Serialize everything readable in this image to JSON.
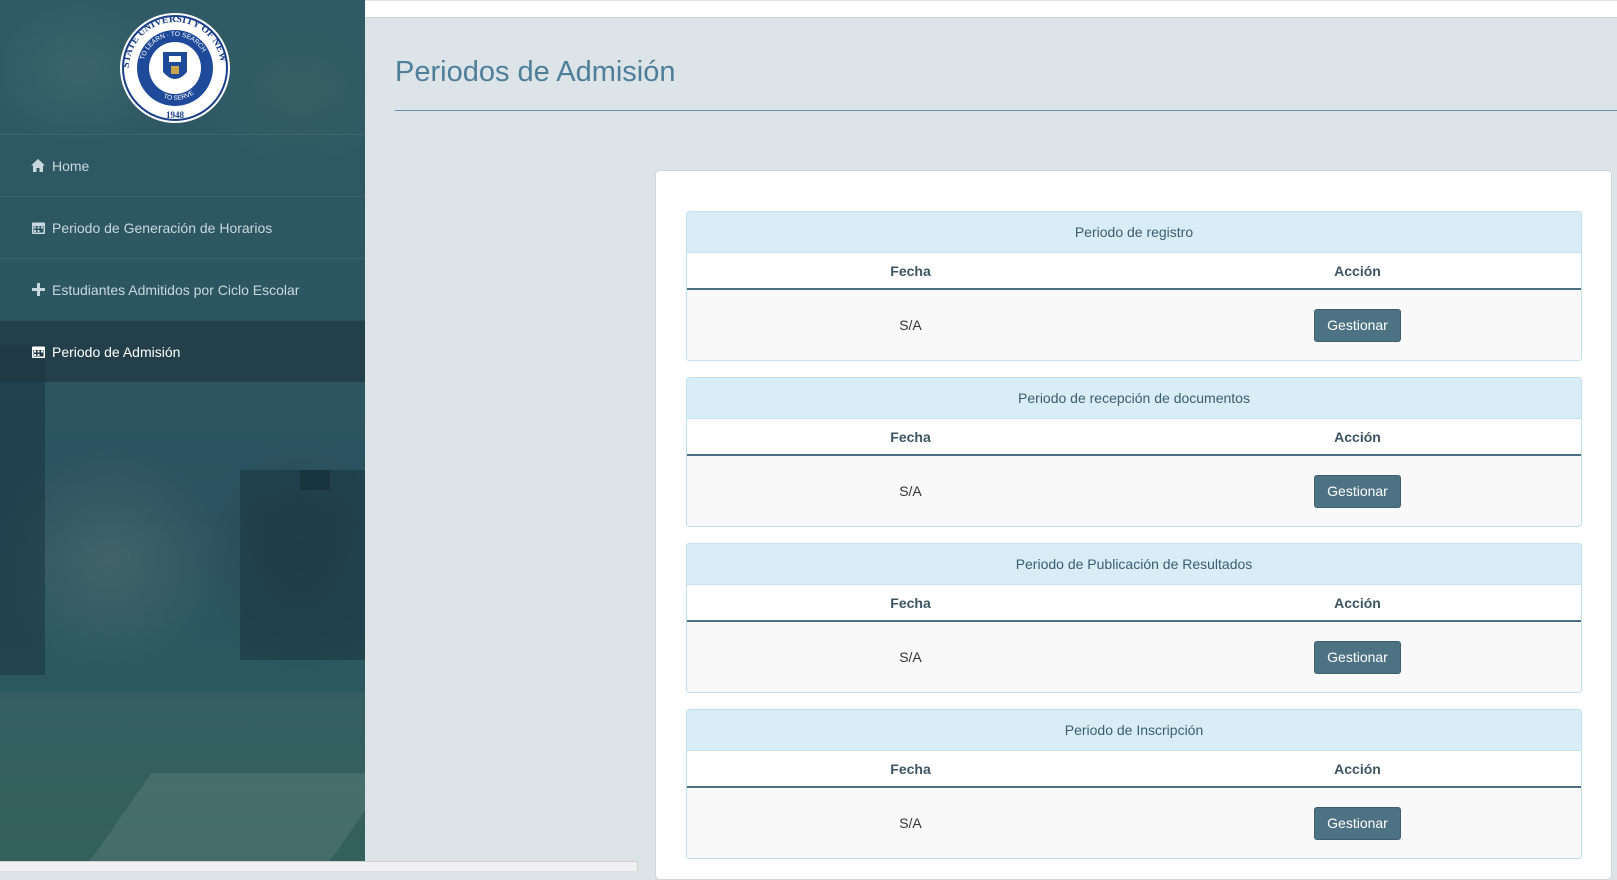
{
  "logo": {
    "ring_top": "STATE UNIVERSITY OF NEW YORK",
    "inner_top": "TO LEARN · TO SEARCH",
    "inner_bottom": "TO SERVE",
    "year": "1948"
  },
  "sidebar": {
    "items": [
      {
        "label": "Home",
        "icon": "home-icon",
        "active": false
      },
      {
        "label": "Periodo de Generación de Horarios",
        "icon": "calendar-icon",
        "active": false
      },
      {
        "label": "Estudiantes Admitidos por Ciclo Escolar",
        "icon": "plus-icon",
        "active": false
      },
      {
        "label": "Periodo de Admisión",
        "icon": "calendar-icon",
        "active": true
      }
    ]
  },
  "header": {
    "title": "Periodos de Admisión"
  },
  "panels": [
    {
      "title": "Periodo de registro",
      "col_fecha": "Fecha",
      "col_accion": "Acción",
      "fecha": "S/A",
      "button": "Gestionar"
    },
    {
      "title": "Periodo de recepción de documentos",
      "col_fecha": "Fecha",
      "col_accion": "Acción",
      "fecha": "S/A",
      "button": "Gestionar"
    },
    {
      "title": "Periodo de Publicación de Resultados",
      "col_fecha": "Fecha",
      "col_accion": "Acción",
      "fecha": "S/A",
      "button": "Gestionar"
    },
    {
      "title": "Periodo de Inscripción",
      "col_fecha": "Fecha",
      "col_accion": "Acción",
      "fecha": "S/A",
      "button": "Gestionar"
    }
  ],
  "colors": {
    "accent": "#4e7f9a",
    "sidebar": "#2c5662",
    "button": "#4d7283",
    "panel_head": "#d9edf7"
  }
}
